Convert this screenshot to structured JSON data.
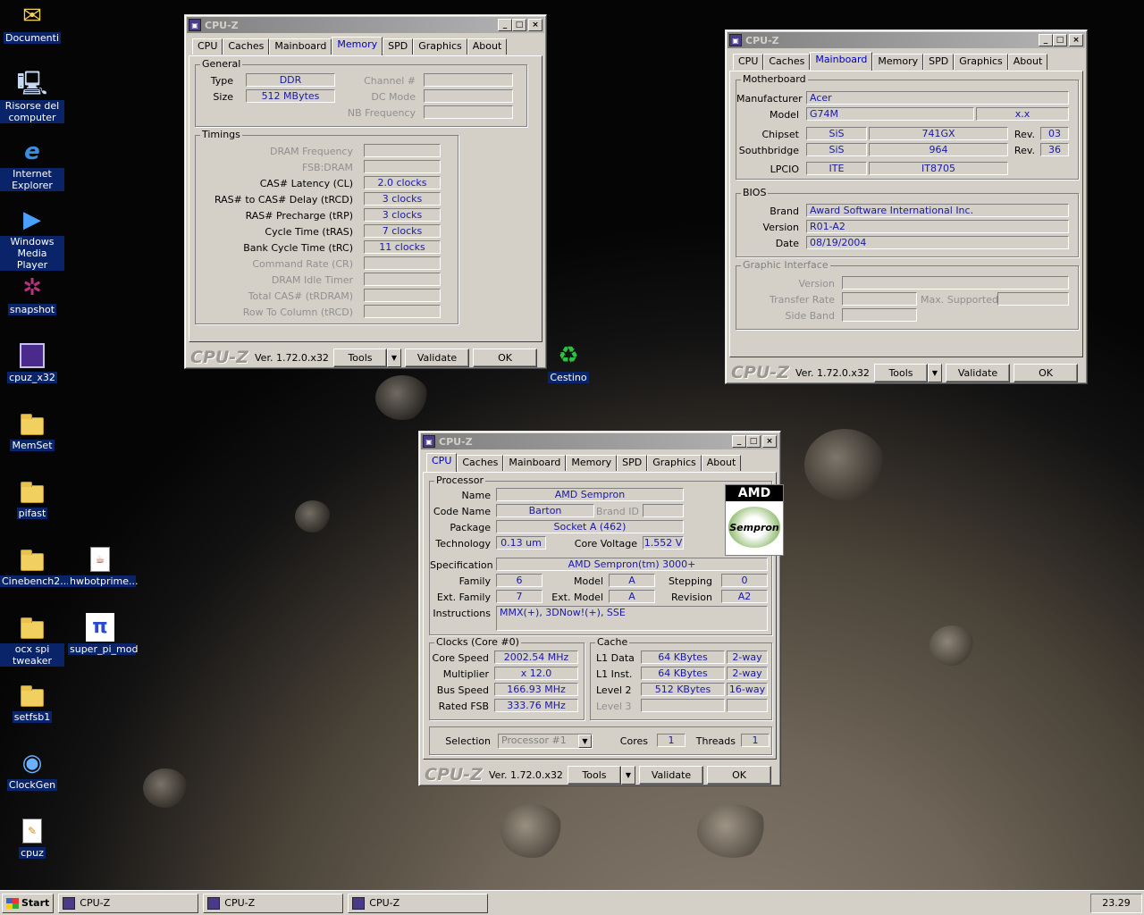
{
  "desktop": {
    "icons": [
      {
        "label": "Documenti",
        "icon": "documents-icon"
      },
      {
        "label": "Risorse del computer",
        "icon": "computer-icon"
      },
      {
        "label": "Internet Explorer",
        "icon": "ie-icon"
      },
      {
        "label": "Windows Media Player",
        "icon": "media-player-icon"
      },
      {
        "label": "snapshot",
        "icon": "snapshot-icon"
      },
      {
        "label": "cpuz_x32",
        "icon": "cpuz-icon"
      },
      {
        "label": "MemSet",
        "icon": "folder-icon"
      },
      {
        "label": "pifast",
        "icon": "folder-icon"
      },
      {
        "label": "Cinebench2...",
        "icon": "folder-icon"
      },
      {
        "label": "hwbotprime...",
        "icon": "java-file-icon"
      },
      {
        "label": "ocx spi tweaker",
        "icon": "folder-icon"
      },
      {
        "label": "super_pi_mod",
        "icon": "superpi-icon"
      },
      {
        "label": "setfsb1",
        "icon": "folder-icon"
      },
      {
        "label": "ClockGen",
        "icon": "clockgen-icon"
      },
      {
        "label": "cpuz",
        "icon": "notepad-file-icon"
      },
      {
        "label": "Cestino",
        "icon": "recycle-bin-icon"
      }
    ]
  },
  "common": {
    "title": "CPU-Z",
    "tabs": [
      "CPU",
      "Caches",
      "Mainboard",
      "Memory",
      "SPD",
      "Graphics",
      "About"
    ],
    "logo": "CPU-Z",
    "version": "Ver. 1.72.0.x32",
    "tools": "Tools",
    "validate": "Validate",
    "ok": "OK",
    "minimize": "_",
    "maximize": "□",
    "close": "×"
  },
  "memory": {
    "general_title": "General",
    "type_label": "Type",
    "type": "DDR",
    "size_label": "Size",
    "size": "512 MBytes",
    "channel_label": "Channel #",
    "channel": "",
    "dcmode_label": "DC Mode",
    "dcmode": "",
    "nbfreq_label": "NB Frequency",
    "nbfreq": "",
    "timings_title": "Timings",
    "timings": [
      {
        "label": "DRAM Frequency",
        "value": "",
        "enabled": false
      },
      {
        "label": "FSB:DRAM",
        "value": "",
        "enabled": false
      },
      {
        "label": "CAS# Latency (CL)",
        "value": "2.0 clocks",
        "enabled": true
      },
      {
        "label": "RAS# to CAS# Delay (tRCD)",
        "value": "3 clocks",
        "enabled": true
      },
      {
        "label": "RAS# Precharge (tRP)",
        "value": "3 clocks",
        "enabled": true
      },
      {
        "label": "Cycle Time (tRAS)",
        "value": "7 clocks",
        "enabled": true
      },
      {
        "label": "Bank Cycle Time (tRC)",
        "value": "11 clocks",
        "enabled": true
      },
      {
        "label": "Command Rate (CR)",
        "value": "",
        "enabled": false
      },
      {
        "label": "DRAM Idle Timer",
        "value": "",
        "enabled": false
      },
      {
        "label": "Total CAS# (tRDRAM)",
        "value": "",
        "enabled": false
      },
      {
        "label": "Row To Column (tRCD)",
        "value": "",
        "enabled": false
      }
    ]
  },
  "mainboard": {
    "mb_title": "Motherboard",
    "manufacturer_label": "Manufacturer",
    "manufacturer": "Acer",
    "model_label": "Model",
    "model": "G74M",
    "model_rev": "x.x",
    "chipset_label": "Chipset",
    "chipset_vendor": "SiS",
    "chipset_model": "741GX",
    "rev_label": "Rev.",
    "chipset_rev": "03",
    "southbridge_label": "Southbridge",
    "sb_vendor": "SiS",
    "sb_model": "964",
    "sb_rev": "36",
    "lpcio_label": "LPCIO",
    "lpcio_vendor": "ITE",
    "lpcio_model": "IT8705",
    "bios_title": "BIOS",
    "brand_label": "Brand",
    "brand": "Award Software International Inc.",
    "version_label": "Version",
    "version": "R01-A2",
    "date_label": "Date",
    "date": "08/19/2004",
    "gi_title": "Graphic Interface",
    "gi_version_label": "Version",
    "gi_transfer_label": "Transfer Rate",
    "gi_max_label": "Max. Supported",
    "gi_side_label": "Side Band"
  },
  "cpu": {
    "proc_title": "Processor",
    "name_label": "Name",
    "name": "AMD Sempron",
    "codename_label": "Code Name",
    "codename": "Barton",
    "brandid_label": "Brand ID",
    "brandid": "",
    "package_label": "Package",
    "package": "Socket A (462)",
    "tech_label": "Technology",
    "tech": "0.13 um",
    "voltage_label": "Core Voltage",
    "voltage": "1.552 V",
    "spec_label": "Specification",
    "spec": "AMD Sempron(tm)   3000+",
    "family_label": "Family",
    "family": "6",
    "model_label": "Model",
    "model": "A",
    "stepping_label": "Stepping",
    "stepping": "0",
    "extfamily_label": "Ext. Family",
    "extfamily": "7",
    "extmodel_label": "Ext. Model",
    "extmodel": "A",
    "revision_label": "Revision",
    "revision": "A2",
    "instr_label": "Instructions",
    "instr": "MMX(+), 3DNow!(+), SSE",
    "logo_top": "AMD",
    "logo_mid": "Sempron",
    "clocks_title": "Clocks (Core #0)",
    "corespeed_label": "Core Speed",
    "corespeed": "2002.54 MHz",
    "mult_label": "Multiplier",
    "mult": "x 12.0",
    "bus_label": "Bus Speed",
    "bus": "166.93 MHz",
    "fsb_label": "Rated FSB",
    "fsb": "333.76 MHz",
    "cache_title": "Cache",
    "l1d_label": "L1 Data",
    "l1d": "64 KBytes",
    "l1d_way": "2-way",
    "l1i_label": "L1 Inst.",
    "l1i": "64 KBytes",
    "l1i_way": "2-way",
    "l2_label": "Level 2",
    "l2": "512 KBytes",
    "l2_way": "16-way",
    "l3_label": "Level 3",
    "selection_label": "Selection",
    "selection": "Processor #1",
    "cores_label": "Cores",
    "cores": "1",
    "threads_label": "Threads",
    "threads": "1"
  },
  "taskbar": {
    "start": "Start",
    "tasks": [
      "CPU-Z",
      "CPU-Z",
      "CPU-Z"
    ],
    "clock": "23.29"
  }
}
